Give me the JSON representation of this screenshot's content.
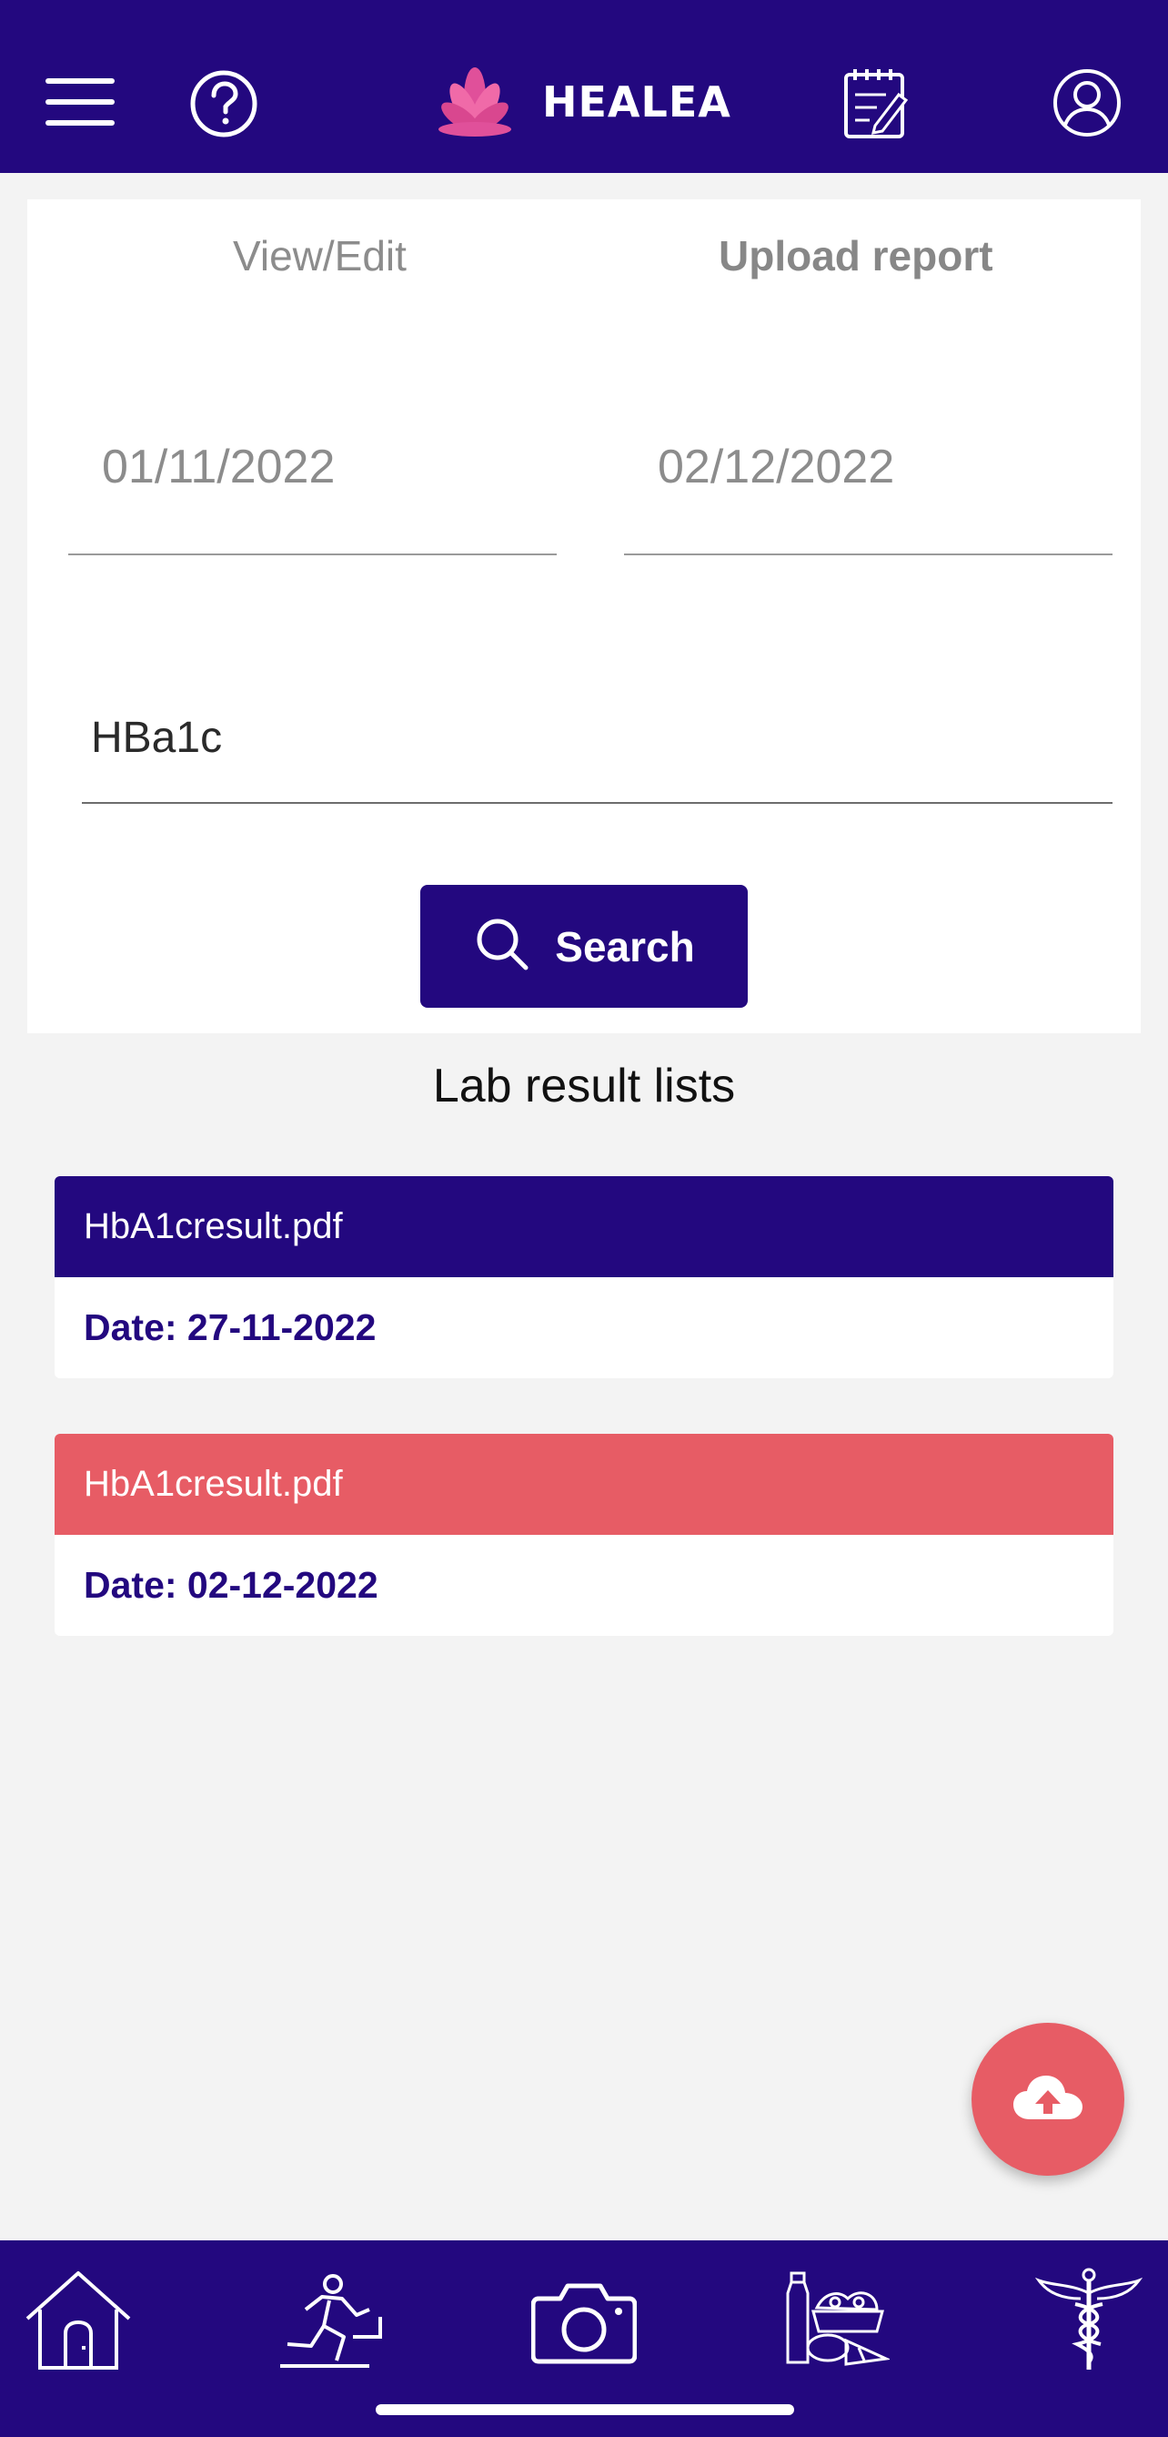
{
  "app": {
    "brand_name": "HEALEA"
  },
  "colors": {
    "primary": "#23087f",
    "accent": "#e75c65",
    "background": "#f3f3f3"
  },
  "header": {
    "icons": [
      "menu-icon",
      "help-icon",
      "lotus-logo-icon",
      "notepad-icon",
      "profile-icon"
    ]
  },
  "tabs": {
    "view_edit": "View/Edit",
    "upload_report": "Upload report"
  },
  "filters": {
    "from_date": "01/11/2022",
    "to_date": "02/12/2022",
    "test_name": "HBa1c"
  },
  "search": {
    "label": "Search"
  },
  "results": {
    "title": "Lab result lists",
    "items": [
      {
        "file": "HbA1cresult.pdf",
        "date": "Date: 27-11-2022",
        "color": "#23087f"
      },
      {
        "file": "HbA1cresult.pdf",
        "date": "Date: 02-12-2022",
        "color": "#e75c65"
      }
    ]
  },
  "fab": {
    "icon": "cloud-upload-icon"
  },
  "bottom_nav": {
    "items": [
      "home-icon",
      "exercise-icon",
      "camera-icon",
      "food-icon",
      "medical-icon"
    ]
  }
}
